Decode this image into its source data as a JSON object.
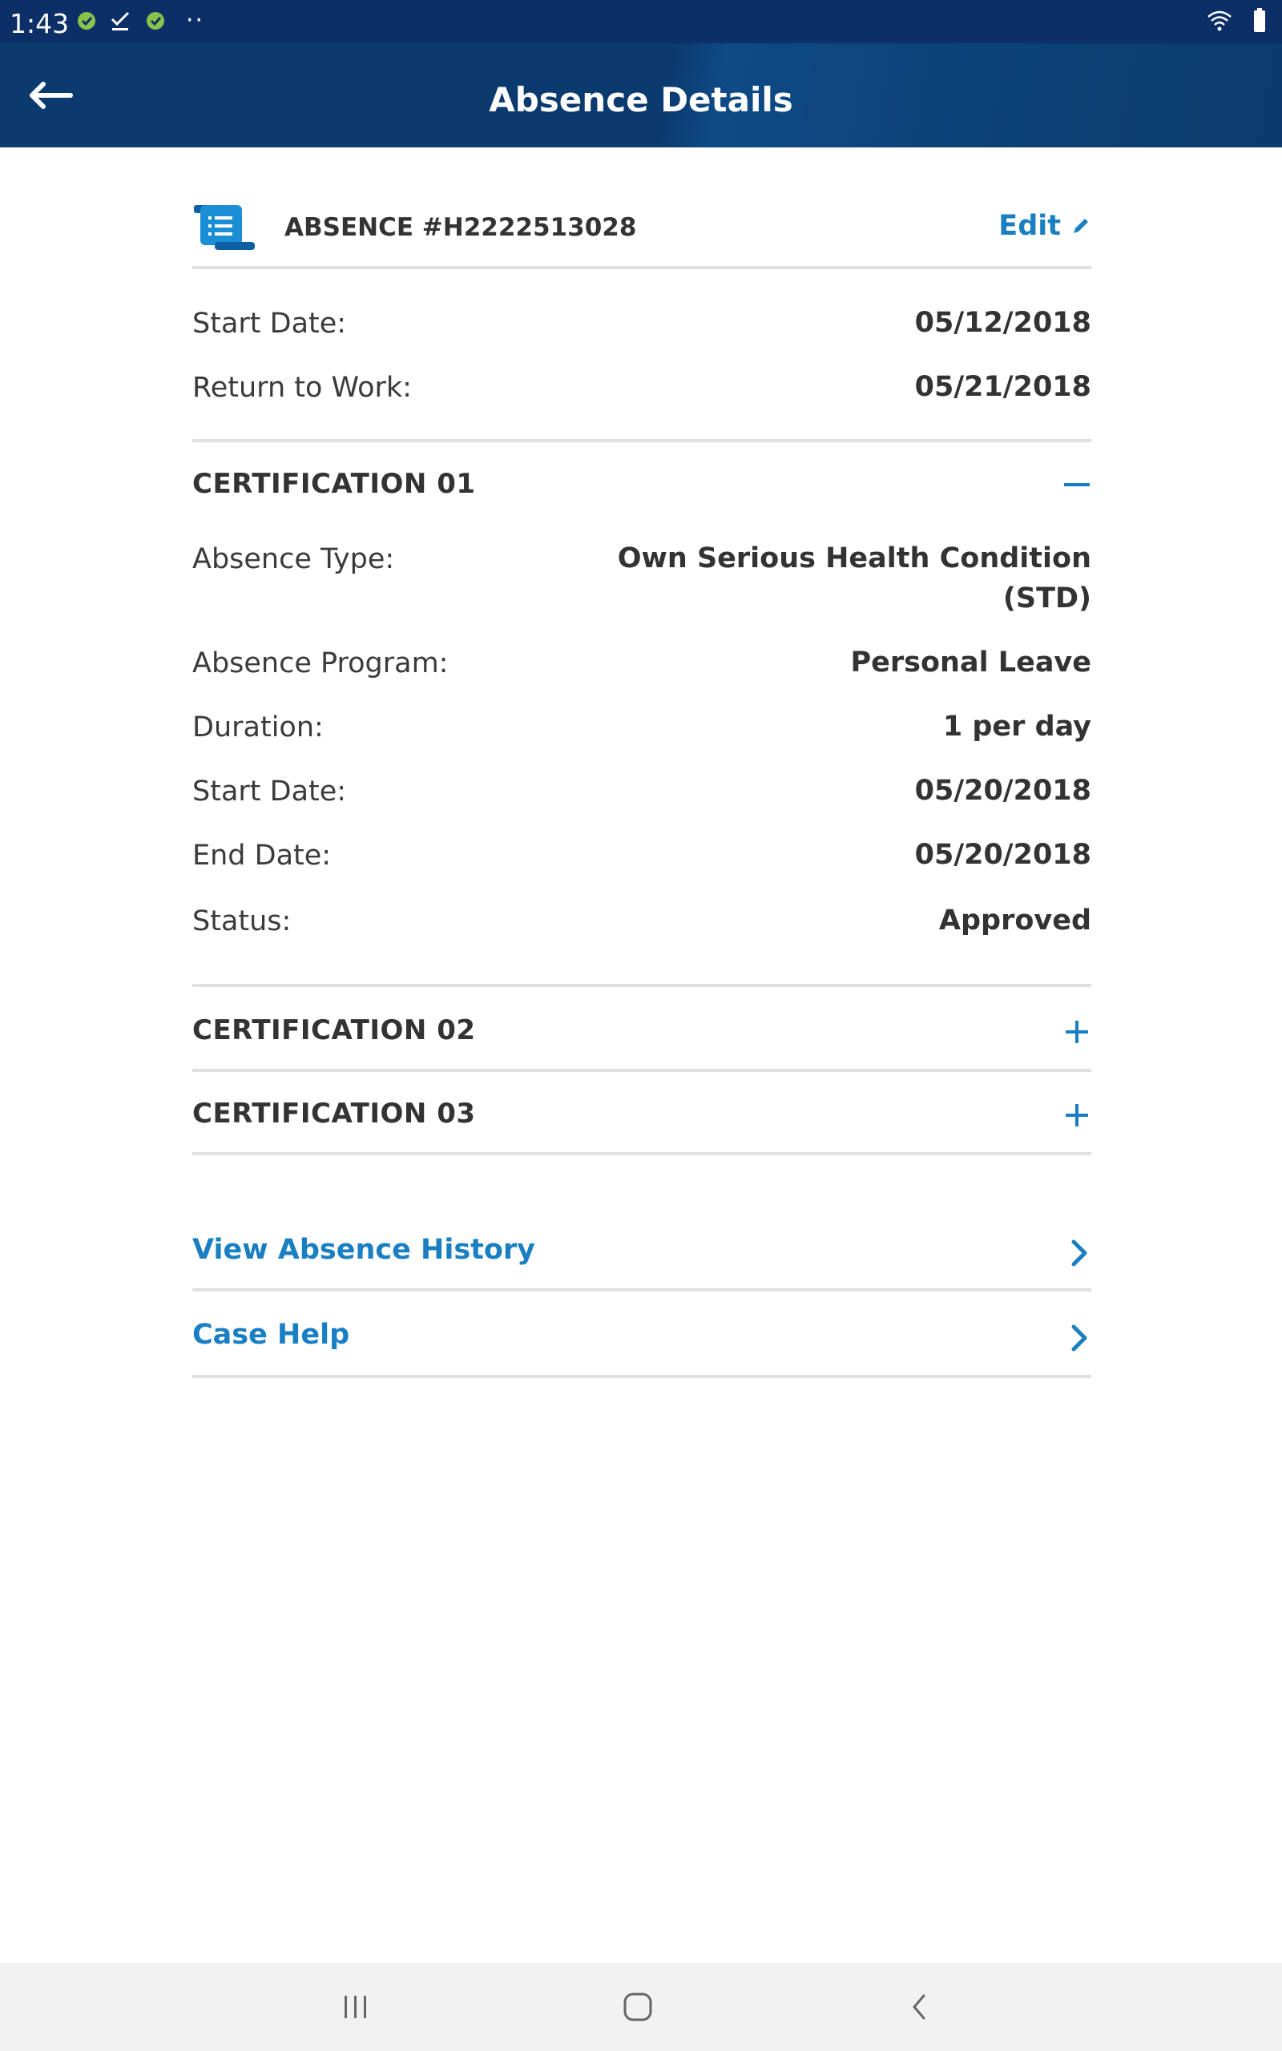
{
  "status_bar": {
    "time": "1:43",
    "dots": "··"
  },
  "app_bar": {
    "title": "Absence Details"
  },
  "absence": {
    "id": "ABSENCE #H2222513028",
    "edit_label": "Edit",
    "start_date_label": "Start Date:",
    "start_date": "05/12/2018",
    "return_label": "Return to Work:",
    "return_date": "05/21/2018"
  },
  "certifications": [
    {
      "title": "CERTIFICATION 01",
      "expanded": true,
      "fields": {
        "absence_type_label": "Absence Type:",
        "absence_type_line1": "Own Serious Health Condition",
        "absence_type_line2": "(STD)",
        "program_label": "Absence Program:",
        "program": "Personal Leave",
        "duration_label": "Duration:",
        "duration": "1 per day",
        "start_label": "Start Date:",
        "start": "05/20/2018",
        "end_label": "End Date:",
        "end": "05/20/2018",
        "status_label": "Status:",
        "status": "Approved"
      }
    },
    {
      "title": "CERTIFICATION 02",
      "expanded": false
    },
    {
      "title": "CERTIFICATION 03",
      "expanded": false
    }
  ],
  "links": {
    "history": "View Absence History",
    "case_help": "Case Help"
  },
  "colors": {
    "header_bg": "#0b3a6e",
    "status_bg": "#0b2f66",
    "accent": "#1a7fc2",
    "divider": "#e0e0e0"
  },
  "icons": {
    "back": "arrow-left-icon",
    "document": "document-scroll-icon",
    "edit": "pencil-icon",
    "collapse": "minus-icon",
    "expand": "plus-icon",
    "link": "chevron-right-icon"
  }
}
